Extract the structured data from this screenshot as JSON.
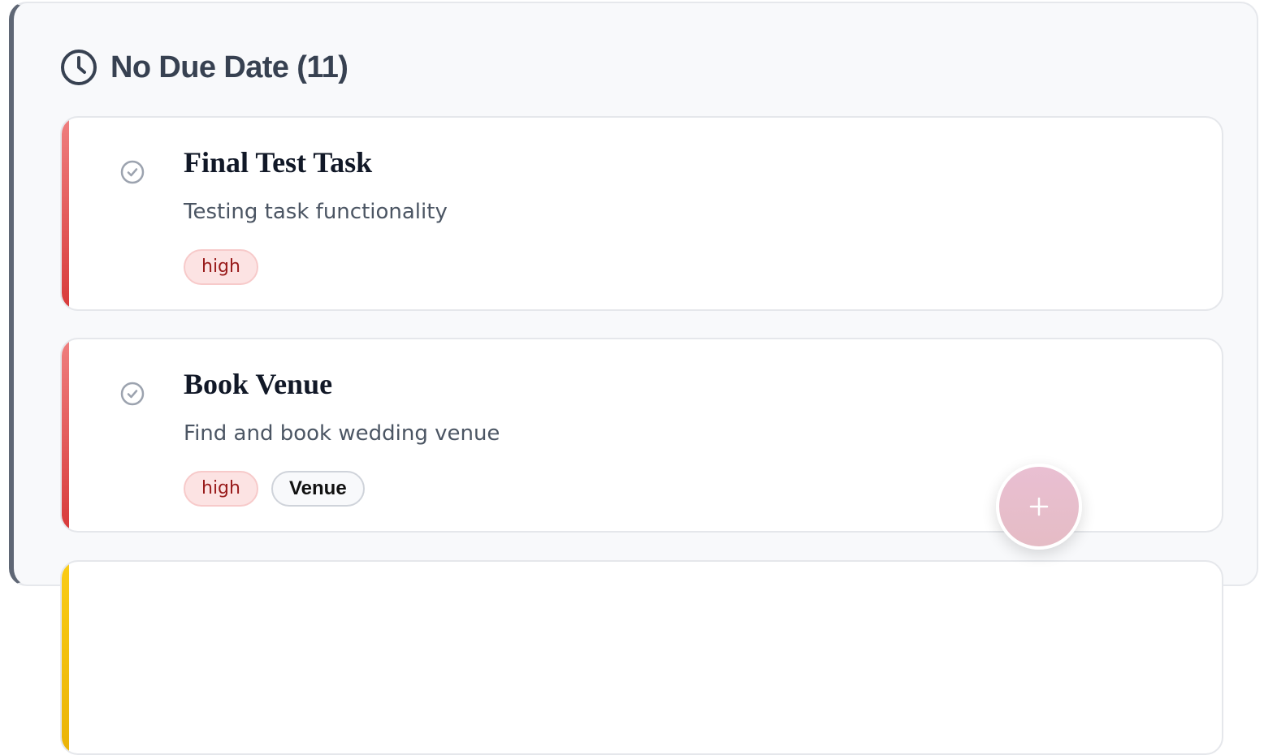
{
  "section": {
    "title": "No Due Date (11)",
    "icon": "clock-icon"
  },
  "tasks": [
    {
      "title": "Final Test Task",
      "description": "Testing task functionality",
      "priority": "high",
      "tags": []
    },
    {
      "title": "Book Venue",
      "description": "Find and book wedding venue",
      "priority": "high",
      "tags": [
        "Venue"
      ]
    }
  ],
  "fab": {
    "icon": "plus-icon"
  },
  "colors": {
    "high_priority": "#d83b3b",
    "medium_priority": "#eab308",
    "fab": "#e9bfd2",
    "section_border": "#5f6775"
  }
}
